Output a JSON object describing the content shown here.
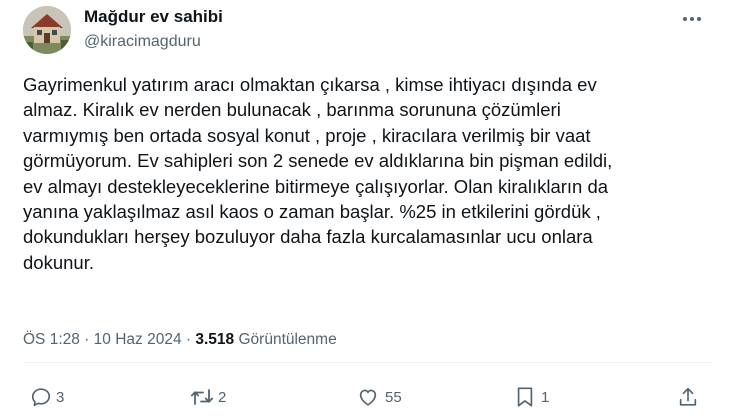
{
  "user": {
    "display_name": "Mağdur ev sahibi",
    "handle": "@kiracimagduru",
    "avatar_icon": "house-photo-avatar"
  },
  "menu_icon": "more-dots-icon",
  "tweet": {
    "lines": [
      "Gayrimenkul yatırım aracı olmaktan çıkarsa , kimse ihtiyacı dışında ev",
      "almaz. Kiralık ev nerden bulunacak , barınma sorununa çözümleri",
      "varmıymış ben ortada sosyal konut , proje , kiracılara verilmiş bir vaat",
      "görmüyorum. Ev sahipleri son 2 senede ev aldıklarına bin pişman edildi,",
      "ev almayı destekleyeceklerine bitirmeye çalışıyorlar. Olan kiralıkların da",
      "yanına yaklaşılmaz asıl kaos o zaman başlar. %25 in etkilerini gördük ,",
      "dokundukları herşey bozuluyor daha fazla kurcalamasınlar ucu onlara",
      "dokunur."
    ]
  },
  "meta": {
    "time": "ÖS 1:28",
    "separator": "·",
    "date": "10 Haz 2024",
    "views_count": "3.518",
    "views_label": "Görüntülenme"
  },
  "actions": {
    "reply_count": "3",
    "retweet_count": "2",
    "like_count": "55",
    "bookmark_count": "1",
    "icons": [
      "reply-icon",
      "retweet-icon",
      "like-icon",
      "bookmark-icon",
      "share-icon"
    ]
  },
  "colors": {
    "text_primary": "#0f1419",
    "text_secondary": "#536471",
    "divider": "#eff3f4"
  }
}
